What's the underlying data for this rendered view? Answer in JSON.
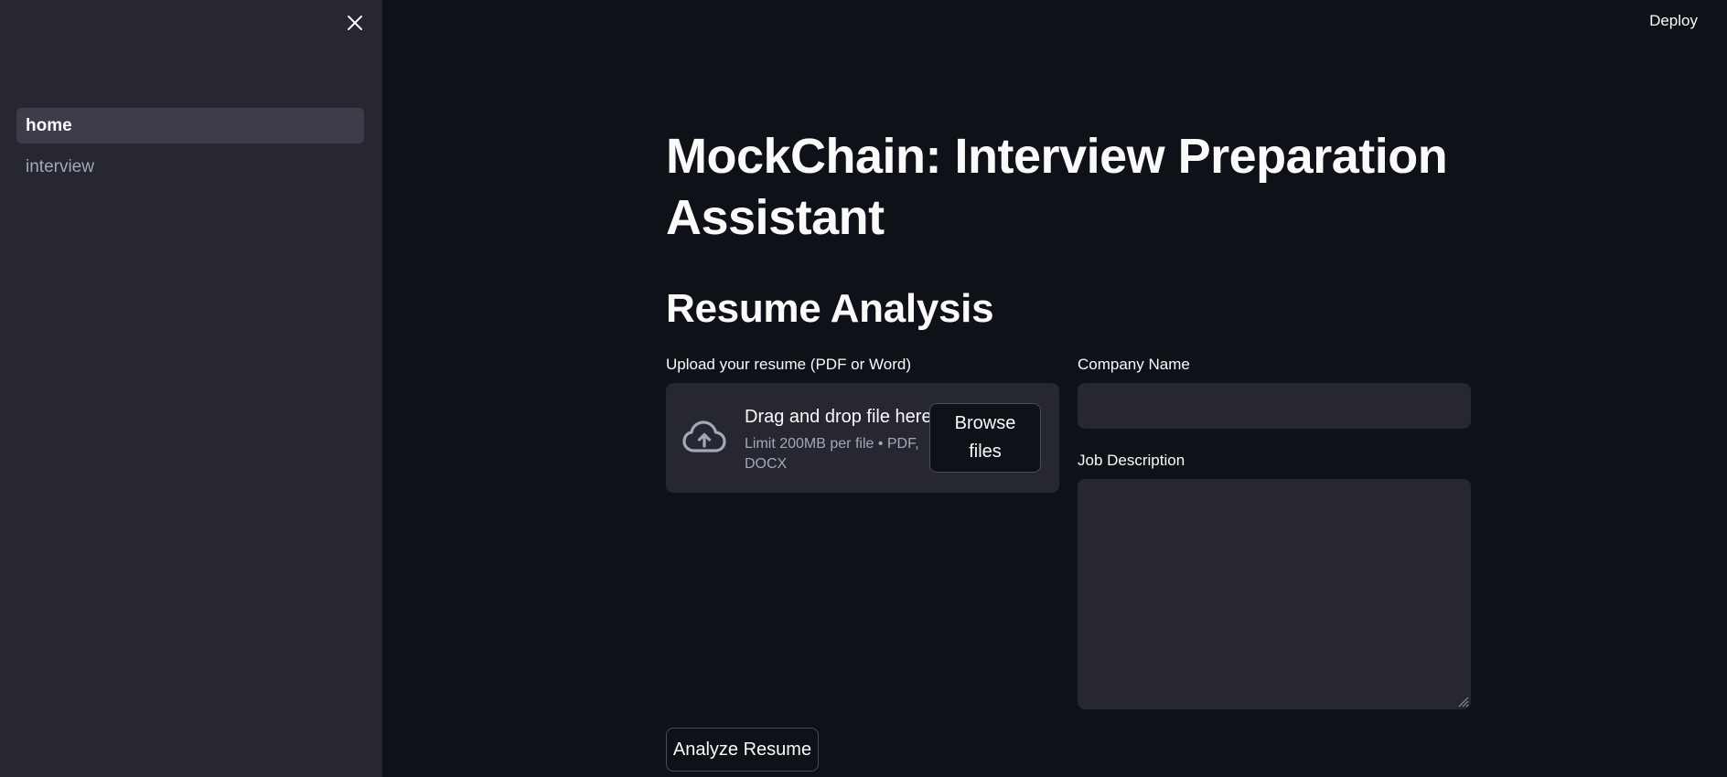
{
  "header": {
    "deploy_label": "Deploy",
    "close_icon": "close-icon"
  },
  "sidebar": {
    "items": [
      {
        "label": "home",
        "active": true
      },
      {
        "label": "interview",
        "active": false
      }
    ]
  },
  "main": {
    "title": "MockChain: Interview Preparation Assistant",
    "section_title": "Resume Analysis",
    "uploader": {
      "label": "Upload your resume (PDF or Word)",
      "icon": "cloud-upload-icon",
      "drag_text": "Drag and drop file here",
      "limit_text": "Limit 200MB per file • PDF, DOCX",
      "browse_label": "Browse files"
    },
    "company": {
      "label": "Company Name",
      "value": ""
    },
    "job_description": {
      "label": "Job Description",
      "value": ""
    },
    "analyze_label": "Analyze Resume"
  },
  "colors": {
    "background": "#0e1117",
    "sidebar": "#262730",
    "input_bg": "#262730",
    "active_nav": "#3d3d4a",
    "text": "#fafafa",
    "muted": "#a3a8b8"
  }
}
